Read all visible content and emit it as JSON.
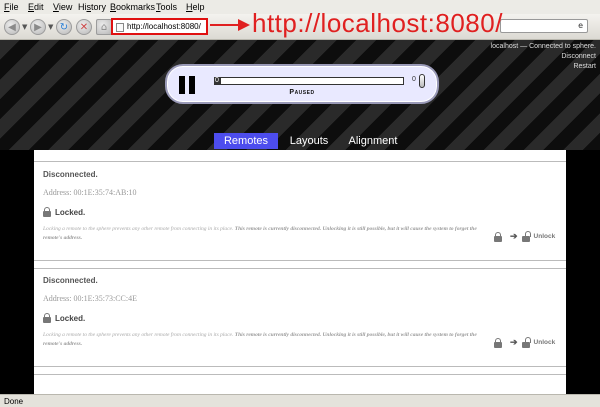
{
  "menu": [
    {
      "key": "F",
      "rest": "ile"
    },
    {
      "key": "E",
      "rest": "dit"
    },
    {
      "key": "V",
      "rest": "iew"
    },
    {
      "key": "",
      "pre": "Hi",
      "ukey": "s",
      "rest": "tory"
    },
    {
      "key": "B",
      "rest": "ookmarks"
    },
    {
      "key": "T",
      "rest": "ools"
    },
    {
      "key": "H",
      "rest": "elp"
    }
  ],
  "address": {
    "url": "http://localhost:8080/"
  },
  "search": {
    "value": "e"
  },
  "annotation": {
    "text": "http://localhost:8080/"
  },
  "connection": {
    "status": "localhost — Connected to sphere.",
    "disconnect": "Disconnect",
    "restart": "Restart"
  },
  "player": {
    "state_label": "Paused",
    "left_value": "0",
    "right_value": "0",
    "progress": 0.03
  },
  "tabs": [
    {
      "label": "Remotes",
      "active": true
    },
    {
      "label": "Layouts",
      "active": false
    },
    {
      "label": "Alignment",
      "active": false
    }
  ],
  "remotes": [
    {
      "status": "Disconnected.",
      "address": "Address: 00:1E:35:74:AB:10",
      "lock": "Locked.",
      "desc_plain": "Locking a remote to the sphere prevents any other remote from connecting in its place. ",
      "desc_bold": "This remote is currently disconnected. Unlocking it is still possible, but it will cause the system to forget the remote's address.",
      "action": "Unlock"
    },
    {
      "status": "Disconnected.",
      "address": "Address: 00:1E:35:73:CC:4E",
      "lock": "Locked.",
      "desc_plain": "Locking a remote to the sphere prevents any other remote from connecting in its place. ",
      "desc_bold": "This remote is currently disconnected. Unlocking it is still possible, but it will cause the system to forget the remote's address.",
      "action": "Unlock"
    }
  ],
  "statusbar": {
    "text": "Done"
  },
  "colors": {
    "active_tab": "#4d4dee",
    "annotation": "#e02020",
    "player_bg": "#e9e9ff"
  }
}
